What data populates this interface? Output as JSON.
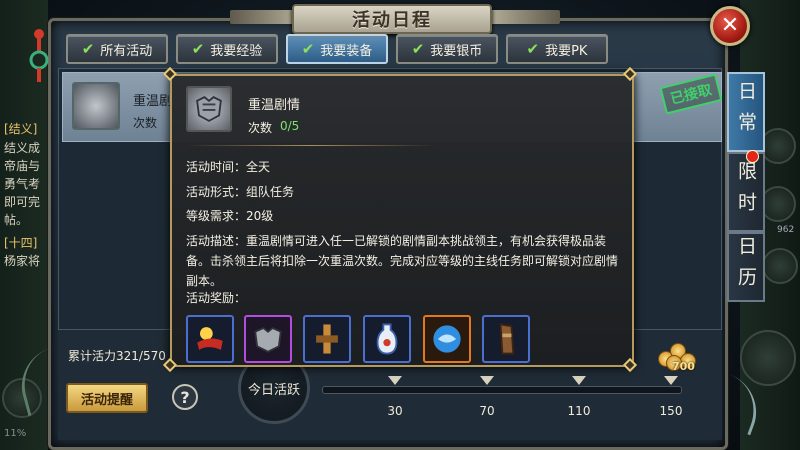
{
  "window": {
    "title": "活动日程"
  },
  "tabs": [
    {
      "label": "所有活动",
      "active": false
    },
    {
      "label": "我要经验",
      "active": false
    },
    {
      "label": "我要装备",
      "active": true
    },
    {
      "label": "我要银币",
      "active": false
    },
    {
      "label": "我要PK",
      "active": false
    }
  ],
  "list_row": {
    "name": "重温剧",
    "count_label": "次数",
    "status": "已接取"
  },
  "side_texts": [
    "[结义]",
    "结义成",
    "帝庙与",
    "勇气考",
    "即可完",
    "帖。",
    "[十四]",
    "杨家将"
  ],
  "side_tabs": [
    {
      "label": "日常",
      "active": true
    },
    {
      "label": "限时",
      "active": false,
      "badge": true
    },
    {
      "label": "日历",
      "active": false
    }
  ],
  "tooltip": {
    "title": "重温剧情",
    "count_label": "次数",
    "count_value": "0/5",
    "time": "活动时间：全天",
    "form": "活动形式：组队任务",
    "level": "等级需求：20级",
    "desc": "活动描述：重温剧情可进入任一已解锁的剧情副本挑战领主，有机会获得极品装备。击杀领主后将扣除一次重温次数。完成对应等级的主线任务即可解锁对应剧情副本。",
    "reward_label": "活动奖励：",
    "rewards": [
      {
        "icon": "red-cloth-icon",
        "quality": "blue"
      },
      {
        "icon": "armor-icon",
        "quality": "purple"
      },
      {
        "icon": "scroll-icon",
        "quality": "blue"
      },
      {
        "icon": "vase-icon",
        "quality": "blue"
      },
      {
        "icon": "blue-orb-icon",
        "quality": "orange"
      },
      {
        "icon": "bracer-icon",
        "quality": "blue"
      }
    ]
  },
  "footer": {
    "vitality": "累计活力321/570",
    "remind_button": "活动提醒",
    "help": "?",
    "today_label": "今日活跃",
    "milestones": [
      "30",
      "70",
      "110",
      "150"
    ],
    "coin_value": "700"
  },
  "background": {
    "hp_percent": "11%",
    "stat": "962"
  },
  "colors": {
    "accent_blue": "#3f79a8",
    "gold": "#b49a5c",
    "count_green": "#7fe36a",
    "close_red": "#c8251a"
  }
}
